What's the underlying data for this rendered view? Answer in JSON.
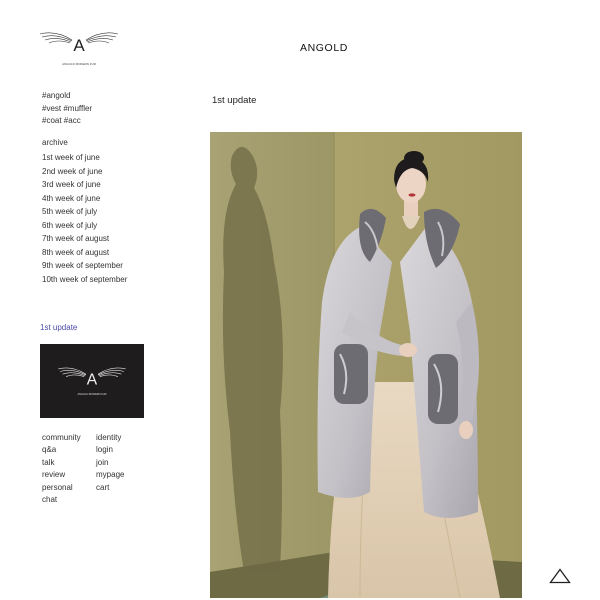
{
  "brand": {
    "name": "ANGOLD",
    "logo_letter": "A",
    "logo_tagline": "ANGOLD MODERN FUR"
  },
  "tags": [
    "#angold",
    "#vest #muffler",
    "#coat #acc"
  ],
  "archive": {
    "title": "archive",
    "items": [
      "1st week of june",
      "2nd week of june",
      "3rd week of june",
      "4th week of june",
      "5th week of july",
      "6th week of july",
      "7th week of august",
      "8th week of august",
      "9th week of september",
      "10th week of september"
    ]
  },
  "sidebar_update": {
    "label": "1st update"
  },
  "footer_nav": {
    "col1": [
      "community",
      "q&a",
      "talk",
      "review",
      "personal",
      "chat"
    ],
    "col2": [
      "identity",
      "login",
      "join",
      "mypage",
      "cart"
    ]
  },
  "main": {
    "post_title": "1st update",
    "photo_icon": "fur-coat-model-photo"
  },
  "scroll_top_icon": "triangle-up-icon",
  "colors": {
    "accent_link": "#4a4aa8",
    "thumb_bg": "#1f1c1d",
    "photo_backdrop": "#a49d6e"
  }
}
